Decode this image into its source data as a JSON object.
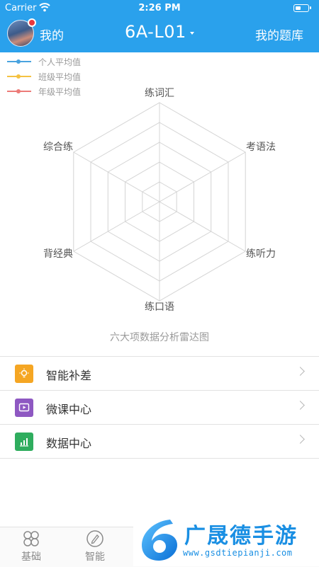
{
  "status_bar": {
    "carrier": "Carrier",
    "time": "2:26 PM"
  },
  "header": {
    "mine_label": "我的",
    "title": "6A-L01",
    "bank_label": "我的题库"
  },
  "legend": [
    {
      "label": "个人平均值",
      "color": "#4aa3df"
    },
    {
      "label": "班级平均值",
      "color": "#f5c242"
    },
    {
      "label": "年级平均值",
      "color": "#ec7b78"
    }
  ],
  "radar": {
    "axes": [
      "练词汇",
      "考语法",
      "练听力",
      "练口语",
      "背经典",
      "综合练"
    ],
    "rings": 5,
    "caption": "六大项数据分析雷达图"
  },
  "menu": [
    {
      "label": "智能补差",
      "icon": "lightbulb-icon",
      "color": "#f5a623"
    },
    {
      "label": "微课中心",
      "icon": "video-play-icon",
      "color": "#8e58c2"
    },
    {
      "label": "数据中心",
      "icon": "bar-chart-icon",
      "color": "#2fad5e"
    }
  ],
  "tabbar": [
    {
      "label": "基础",
      "icon": "grid-clover-icon"
    },
    {
      "label": "智能",
      "icon": "pencil-icon"
    }
  ],
  "watermark": {
    "brand": "广晟德手游",
    "url": "www.gsdtiepianji.com"
  }
}
